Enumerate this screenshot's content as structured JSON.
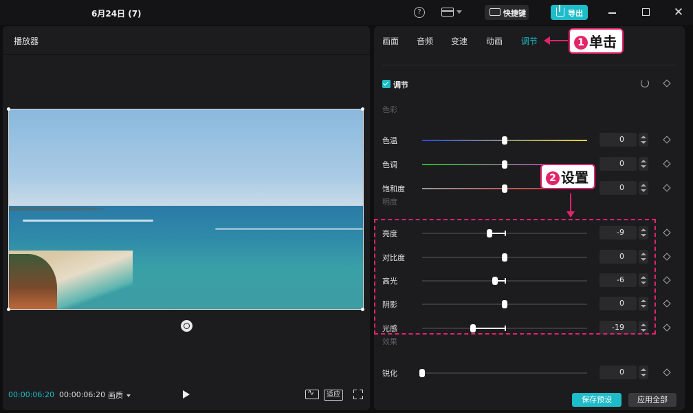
{
  "titlebar": {
    "project_name": "6月24日 (7)",
    "shortcut_label": "快捷键",
    "export_label": "导出"
  },
  "player": {
    "title": "播放器",
    "current_time": "00:00:06:20",
    "total_time": "00:00:06:20",
    "quality_label": "画质",
    "fit_label": "适应"
  },
  "panel": {
    "tabs": [
      "画面",
      "音频",
      "变速",
      "动画",
      "调节"
    ],
    "active_tab": "调节",
    "section_title": "调节",
    "groups": {
      "color": "色彩",
      "light": "明度",
      "effect": "效果"
    },
    "sliders": [
      {
        "label": "色温",
        "value": "0",
        "position": 0.5
      },
      {
        "label": "色调",
        "value": "0",
        "position": 0.5
      },
      {
        "label": "饱和度",
        "value": "0",
        "position": 0.5
      },
      {
        "label": "亮度",
        "value": "-9",
        "position": 0.41
      },
      {
        "label": "对比度",
        "value": "0",
        "position": 0.5
      },
      {
        "label": "高光",
        "value": "-6",
        "position": 0.44
      },
      {
        "label": "阴影",
        "value": "0",
        "position": 0.5
      },
      {
        "label": "光感",
        "value": "-19",
        "position": 0.31
      },
      {
        "label": "锐化",
        "value": "0",
        "position": 0.0
      }
    ],
    "save_preset_label": "保存预设",
    "apply_all_label": "应用全部"
  },
  "annotations": {
    "step1": {
      "num": "1",
      "text": "单击"
    },
    "step2": {
      "num": "2",
      "text": "设置"
    }
  },
  "colors": {
    "accent": "#1dbcc8",
    "annotation": "#e4246a"
  }
}
